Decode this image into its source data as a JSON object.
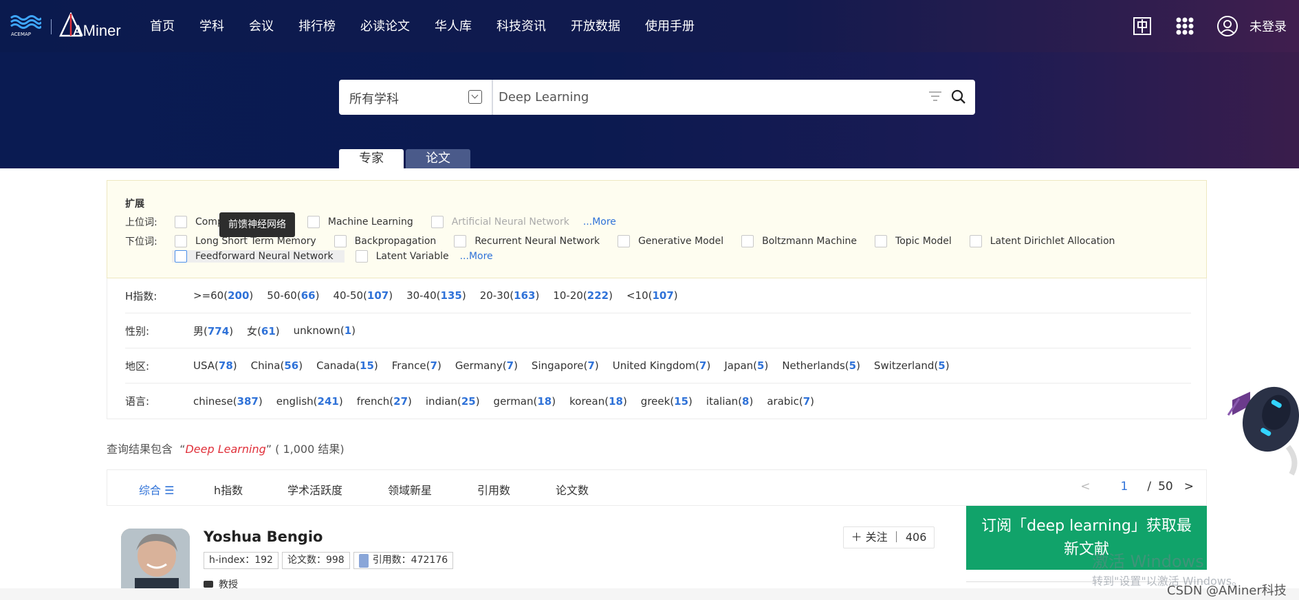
{
  "header": {
    "logo_aminer": "AMiner",
    "logo_acemap": "ACEMAP",
    "nav": [
      "首页",
      "学科",
      "会议",
      "排行榜",
      "必读论文",
      "华人库",
      "科技资讯",
      "开放数据",
      "使用手册"
    ],
    "login_label": "未登录"
  },
  "search": {
    "category": "所有学科",
    "query": "Deep Learning"
  },
  "tabs": [
    "专家",
    "论文"
  ],
  "expansion": {
    "title": "扩展",
    "hypernym_label": "上位词:",
    "hypernyms": [
      "Comp",
      "Machine Learning",
      "Artificial Neural Network"
    ],
    "hyponym_label": "下位词:",
    "hyponyms_row1": [
      "Long Short Term Memory",
      "Backpropagation",
      "Recurrent Neural Network",
      "Generative Model",
      "Boltzmann Machine",
      "Topic Model",
      "Latent Dirichlet Allocation"
    ],
    "hyponyms_row2": [
      "Feedforward Neural Network",
      "Latent Variable"
    ],
    "more_label": "...More",
    "tooltip": "前馈神经网络"
  },
  "facets": {
    "hindex": {
      "label": "H指数:",
      "options": [
        {
          "name": ">=60",
          "count": "200"
        },
        {
          "name": "50-60",
          "count": "66"
        },
        {
          "name": "40-50",
          "count": "107"
        },
        {
          "name": "30-40",
          "count": "135"
        },
        {
          "name": "20-30",
          "count": "163"
        },
        {
          "name": "10-20",
          "count": "222"
        },
        {
          "name": "<10",
          "count": "107"
        }
      ]
    },
    "gender": {
      "label": "性别:",
      "options": [
        {
          "name": "男",
          "count": "774"
        },
        {
          "name": "女",
          "count": "61"
        },
        {
          "name": "unknown",
          "count": "1"
        }
      ]
    },
    "region": {
      "label": "地区:",
      "options": [
        {
          "name": "USA",
          "count": "78"
        },
        {
          "name": "China",
          "count": "56"
        },
        {
          "name": "Canada",
          "count": "15"
        },
        {
          "name": "France",
          "count": "7"
        },
        {
          "name": "Germany",
          "count": "7"
        },
        {
          "name": "Singapore",
          "count": "7"
        },
        {
          "name": "United Kingdom",
          "count": "7"
        },
        {
          "name": "Japan",
          "count": "5"
        },
        {
          "name": "Netherlands",
          "count": "5"
        },
        {
          "name": "Switzerland",
          "count": "5"
        }
      ]
    },
    "language": {
      "label": "语言:",
      "options": [
        {
          "name": "chinese",
          "count": "387"
        },
        {
          "name": "english",
          "count": "241"
        },
        {
          "name": "french",
          "count": "27"
        },
        {
          "name": "indian",
          "count": "25"
        },
        {
          "name": "german",
          "count": "18"
        },
        {
          "name": "korean",
          "count": "18"
        },
        {
          "name": "greek",
          "count": "15"
        },
        {
          "name": "italian",
          "count": "8"
        },
        {
          "name": "arabic",
          "count": "7"
        }
      ]
    }
  },
  "results": {
    "prefix": "查询结果包含",
    "query": "Deep Learning",
    "count_text": "( 1,000 结果)"
  },
  "sort": {
    "options": [
      "综合",
      "h指数",
      "学术活跃度",
      "领域新星",
      "引用数",
      "论文数"
    ],
    "page_current": "1",
    "page_sep": "/",
    "page_total": "50"
  },
  "expert": {
    "name": "Yoshua Bengio",
    "hindex": "h-index：192",
    "papers": "论文数：998",
    "citations": "引用数：472176",
    "institution": "教授",
    "follow_label": "关注",
    "follow_count": "406"
  },
  "subscribe": {
    "line1": "订阅「deep learning」获取最",
    "line2": "新文献"
  },
  "watermarks": {
    "windows1": "激活 Windows",
    "windows2": "转到\"设置\"以激活 Windows。",
    "csdn": "CSDN @AMiner科技"
  }
}
